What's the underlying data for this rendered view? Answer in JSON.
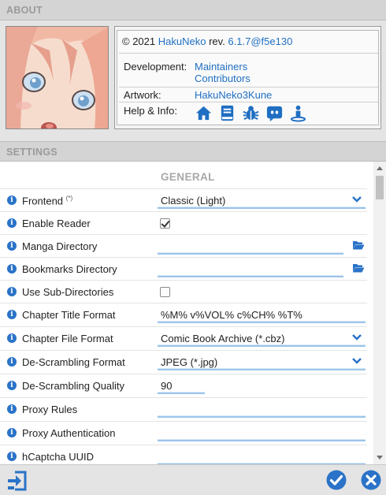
{
  "about": {
    "header": "ABOUT",
    "copyright": "© 2021",
    "app_name": "HakuNeko",
    "rev_label": "rev.",
    "version": "6.1.7@f5e130",
    "development_label": "Development:",
    "development_links": [
      "Maintainers",
      "Contributors"
    ],
    "artwork_label": "Artwork:",
    "artwork_link": "HakuNeko3Kune",
    "help_label": "Help & Info:",
    "help_icons": [
      "home-icon",
      "book-icon",
      "bug-icon",
      "discord-icon",
      "person-icon"
    ],
    "link_color": "#1f6fc2"
  },
  "settings": {
    "header": "SETTINGS",
    "group_title": "GENERAL",
    "rows": [
      {
        "label": "Frontend",
        "note": "(*)",
        "type": "select",
        "value": "Classic (Light)"
      },
      {
        "label": "Enable Reader",
        "type": "checkbox",
        "checked": true
      },
      {
        "label": "Manga Directory",
        "type": "folder",
        "value": ""
      },
      {
        "label": "Bookmarks Directory",
        "type": "folder",
        "value": ""
      },
      {
        "label": "Use Sub-Directories",
        "type": "checkbox",
        "checked": false
      },
      {
        "label": "Chapter Title Format",
        "type": "text",
        "value": "%M% v%VOL% c%CH% %T%"
      },
      {
        "label": "Chapter File Format",
        "type": "select",
        "value": "Comic Book Archive (*.cbz)"
      },
      {
        "label": "De-Scrambling Format",
        "type": "select",
        "value": "JPEG (*.jpg)"
      },
      {
        "label": "De-Scrambling Quality",
        "type": "number",
        "value": "90"
      },
      {
        "label": "Proxy Rules",
        "type": "text",
        "value": ""
      },
      {
        "label": "Proxy Authentication",
        "type": "text",
        "value": ""
      },
      {
        "label": "hCaptcha UUID",
        "type": "text",
        "value": ""
      }
    ],
    "accent_color": "#2a73c8"
  },
  "footer": {
    "buttons": [
      "import-icon",
      "confirm-icon",
      "close-icon"
    ]
  }
}
